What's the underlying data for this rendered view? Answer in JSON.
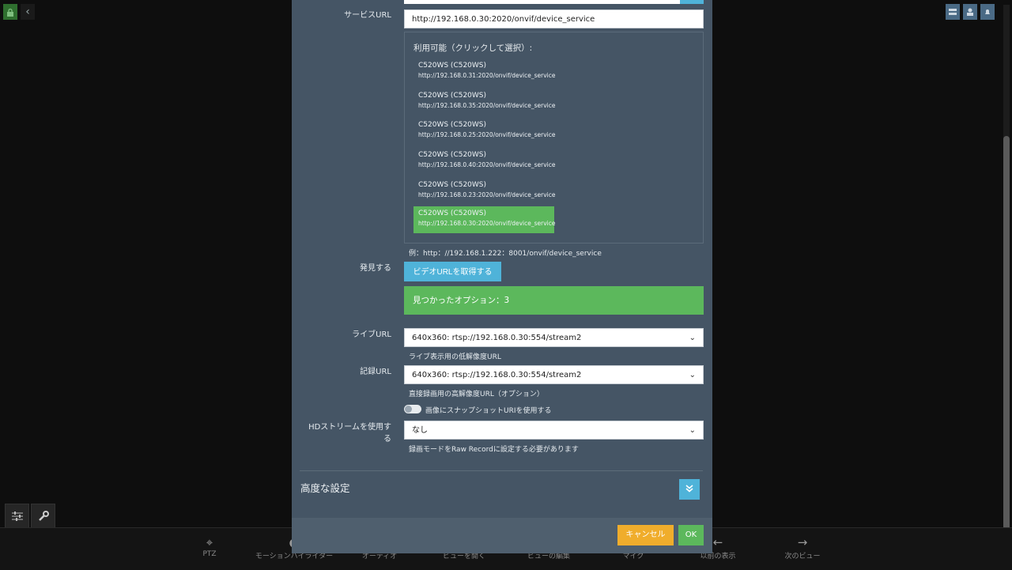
{
  "background": {
    "bottom_bar": [
      {
        "icon": "crosshair-icon",
        "label": "PTZ"
      },
      {
        "icon": "highlighter-icon",
        "label": "モーションハイライター"
      },
      {
        "icon": "audio-icon",
        "label": "オーディオ"
      },
      {
        "icon": "open-view-icon",
        "label": "ビューを開く"
      },
      {
        "icon": "edit-view-icon",
        "label": "ビューの編集"
      },
      {
        "icon": "mic-icon",
        "label": "マイク"
      },
      {
        "icon": "arrow-left-icon",
        "label": "以前の表示"
      },
      {
        "icon": "arrow-right-icon",
        "label": "次のビュー"
      }
    ]
  },
  "form": {
    "service_url": {
      "label": "サービスURL",
      "value": "http://192.168.0.30:2020/onvif/device_service",
      "available_title": "利用可能（クリックして選択）:",
      "devices": [
        {
          "name": "C520WS (C520WS)",
          "url": "http://192.168.0.31:2020/onvif/device_service"
        },
        {
          "name": "C520WS (C520WS)",
          "url": "http://192.168.0.35:2020/onvif/device_service"
        },
        {
          "name": "C520WS (C520WS)",
          "url": "http://192.168.0.25:2020/onvif/device_service"
        },
        {
          "name": "C520WS (C520WS)",
          "url": "http://192.168.0.40:2020/onvif/device_service"
        },
        {
          "name": "C520WS (C520WS)",
          "url": "http://192.168.0.23:2020/onvif/device_service"
        },
        {
          "name": "C520WS (C520WS)",
          "url": "http://192.168.0.30:2020/onvif/device_service",
          "selected": true
        }
      ],
      "example": "例：http：//192.168.1.222：8001/onvif/device_service"
    },
    "discover": {
      "label": "発見する",
      "button": "ビデオURLを取得する",
      "result": "見つかったオプション：3"
    },
    "live_url": {
      "label": "ライブURL",
      "value": "640x360: rtsp://192.168.0.30:554/stream2",
      "help": "ライブ表示用の低解像度URL"
    },
    "record_url": {
      "label": "記録URL",
      "value": "640x360: rtsp://192.168.0.30:554/stream2",
      "help": "直接録画用の高解像度URL（オプション）"
    },
    "snapshot_toggle": {
      "label": "画像にスナップショットURIを使用する",
      "on": false
    },
    "hd_stream": {
      "label_line1": "HDストリームを使用す",
      "label_line2": "る",
      "value": "なし",
      "help": "録画モードをRaw Recordに設定する必要があります"
    },
    "advanced": {
      "title": "高度な設定"
    }
  },
  "footer": {
    "cancel": "キャンセル",
    "ok": "OK"
  },
  "colors": {
    "accent_blue": "#4fb3d9",
    "success_green": "#5cb85c",
    "warning_orange": "#f0ad2c",
    "modal_bg": "#455565"
  }
}
